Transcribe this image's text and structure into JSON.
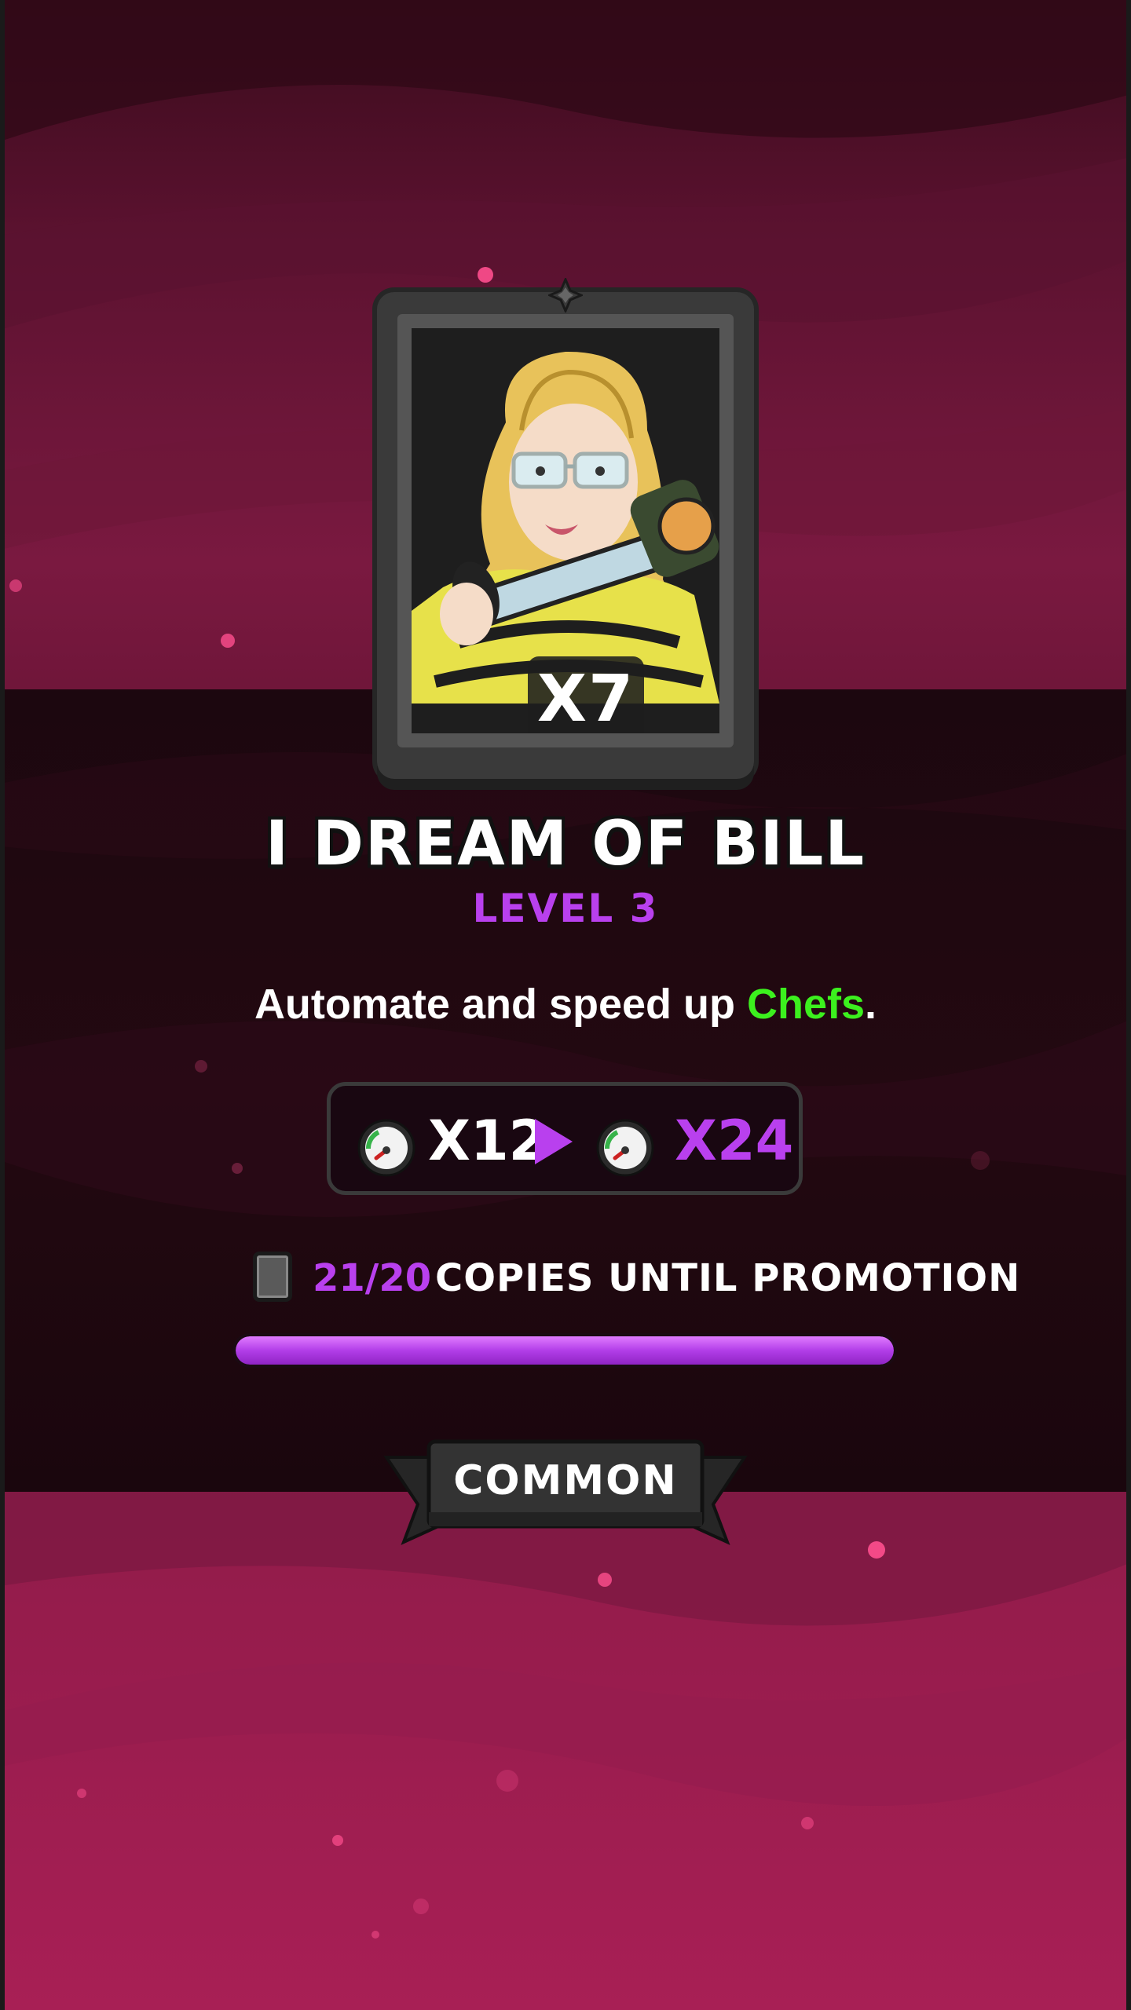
{
  "card": {
    "name": "I DREAM OF BILL",
    "level": "LEVEL 3",
    "copies_owned": "X7",
    "portrait": "character-portrait",
    "rarity": "COMMON"
  },
  "description": {
    "prefix": "Automate and speed up ",
    "highlight": "Chefs",
    "suffix": "."
  },
  "stat": {
    "icon": "speedometer-icon",
    "current": "X12",
    "next": "X24"
  },
  "promotion": {
    "count": "21/20",
    "label": "COPIES UNTIL PROMOTION",
    "progress": 1.0
  },
  "colors": {
    "accent_purple": "#b940ee",
    "highlight_green": "#3cf01e",
    "background_pink": "#a81f55",
    "band_dark": "#1f0810"
  }
}
